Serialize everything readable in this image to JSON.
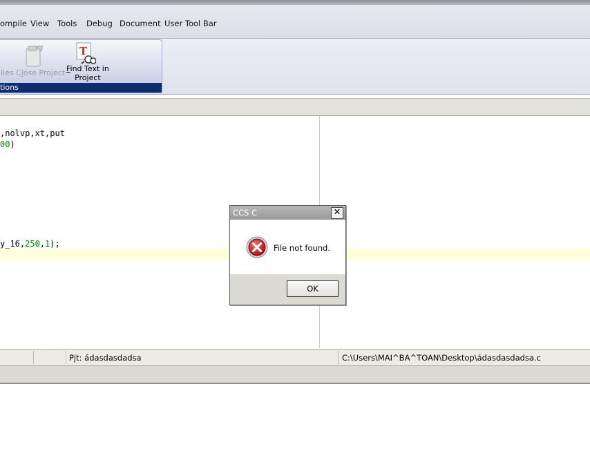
{
  "menubar": {
    "items": [
      "ompile",
      "View",
      "Tools",
      "Debug",
      "Document",
      "User Tool Bar"
    ]
  },
  "ribbon": {
    "files_label": "iles",
    "close_project": {
      "prefix": "C",
      "accel": "l",
      "rest": "ose Project"
    },
    "find_text": {
      "accel": "F",
      "line1_rest": "ind Text in",
      "line2": "Project"
    },
    "group_label": "tions"
  },
  "editor": {
    "line1": {
      "text": ",nolvp,xt,put"
    },
    "line2": {
      "num": "00",
      "punct": ")"
    },
    "line3": {
      "a": "y_16,",
      "n1": "250",
      "c1": ",",
      "n2": "1",
      "b": ");"
    }
  },
  "statusbar": {
    "project": "Pjt: ádasdasdadsa",
    "path": "C:\\Users\\MAI^BA^TOAN\\Desktop\\ádasdasdadsa.c"
  },
  "dialog": {
    "title": "CCS C",
    "close_glyph": "✕",
    "message": "File not found.",
    "ok_label": "OK",
    "icon": "error-icon"
  },
  "colors": {
    "ribbon_group_label_bg": "#0f2d6e",
    "code_number": "#008000",
    "current_line": "#ffffdc",
    "error_red": "#c8141e"
  }
}
